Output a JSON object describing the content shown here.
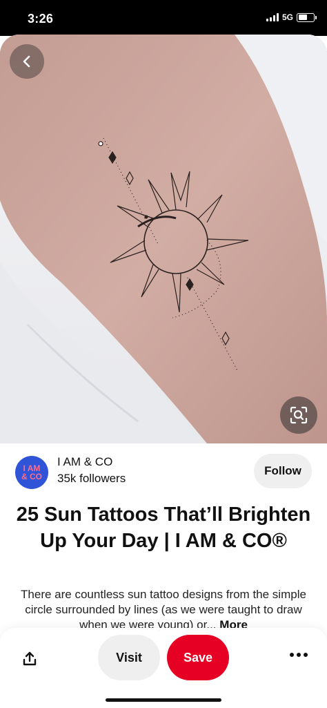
{
  "status_bar": {
    "time": "3:26",
    "network": "5G"
  },
  "image": {
    "back_icon": "chevron-left-icon",
    "lens_icon": "visual-search-icon"
  },
  "creator": {
    "avatar_line1": "I AM",
    "avatar_line2": "& CO",
    "name": "I AM & CO",
    "followers": "35k followers",
    "follow_label": "Follow",
    "avatar_color": "#2f54d8",
    "avatar_text_color": "#ff6d8a"
  },
  "pin": {
    "title": "25 Sun Tattoos That’ll Brighten Up Your Day | I AM & CO®",
    "description": "There are countless sun tattoo designs from the simple circle surrounded by lines (as we were taught to draw when we were young) or...",
    "more_label": "More"
  },
  "actions": {
    "share_icon": "share-icon",
    "visit_label": "Visit",
    "save_label": "Save",
    "more_icon": "more-options-icon",
    "save_color": "#e60023"
  }
}
